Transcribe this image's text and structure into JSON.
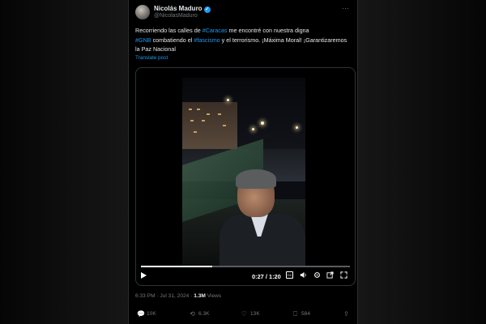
{
  "tweet": {
    "author_name": "Nicolás Maduro",
    "author_handle": "@NicolasMaduro",
    "verified_mark": "✓",
    "more": "···",
    "text_segments": [
      {
        "t": "Recorriendo las calles de ",
        "tag": false
      },
      {
        "t": "#Caracas",
        "tag": true
      },
      {
        "t": " me encontré con nuestra digna ",
        "tag": false
      },
      {
        "t": "#GNB",
        "tag": true
      },
      {
        "t": " combatiendo el ",
        "tag": false
      },
      {
        "t": "#fascismo",
        "tag": true
      },
      {
        "t": " y el terrorismo. ¡Máxima Moral! ¡Garantizaremos la Paz Nacional",
        "tag": false
      }
    ],
    "translate_label": "Translate post",
    "timestamp": "6:33 PM · Jul 31, 2024 · ",
    "views": "1.3M",
    "views_label": " Views"
  },
  "video": {
    "time": "0:27 / 1:20",
    "progress": 0.34
  },
  "actions": {
    "replies": "10K",
    "reposts": "6.3K",
    "likes": "13K",
    "bookmarks": "584"
  },
  "colors": {
    "accent": "#1d9bf0",
    "text": "#e7e9ea",
    "muted": "#71767b"
  },
  "icons": [
    "verified-icon",
    "more-icon",
    "play-icon",
    "captions-icon",
    "settings-icon",
    "volume-icon",
    "fullscreen-icon",
    "reply-icon",
    "repost-icon",
    "like-icon",
    "bookmark-icon",
    "share-icon"
  ]
}
